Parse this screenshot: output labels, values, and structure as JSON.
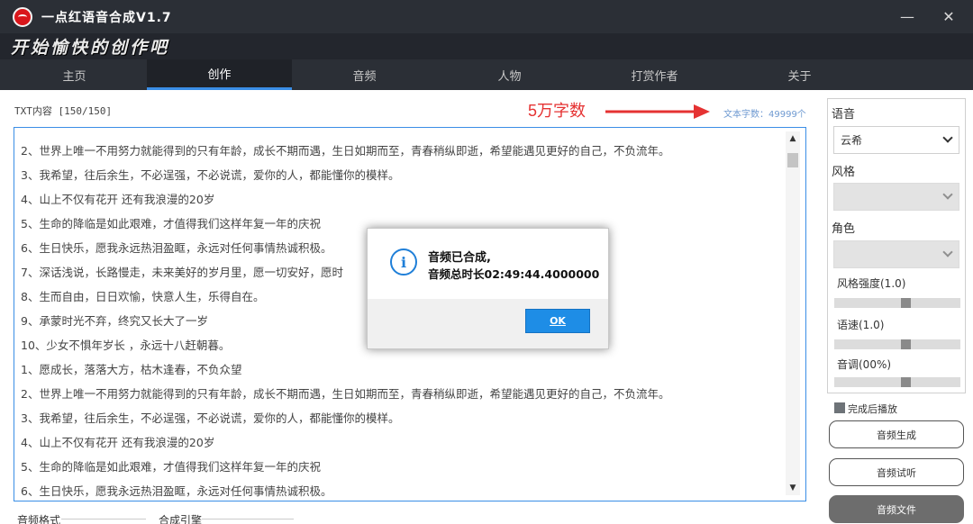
{
  "app": {
    "title": "一点红语音合成V1.7",
    "slogan": "开始愉快的创作吧"
  },
  "window_controls": {
    "minimize": "—",
    "close": "✕"
  },
  "nav": {
    "tabs": [
      "主页",
      "创作",
      "音频",
      "人物",
      "打赏作者",
      "关于"
    ],
    "active": "创作"
  },
  "editor": {
    "content_label": "TXT内容 [150/150]",
    "annotation": "5万字数",
    "char_count": "文本字数：49999个",
    "lines": [
      "2、世界上唯一不用努力就能得到的只有年龄，成长不期而遇，生日如期而至，青春稍纵即逝，希望能遇见更好的自己，不负流年。",
      "3、我希望，往后余生，不必逞强，不必说谎，爱你的人，都能懂你的模样。",
      "4、山上不仅有花开 还有我浪漫的20岁",
      "5、生命的降临是如此艰难，才值得我们这样年复一年的庆祝",
      "6、生日快乐，愿我永远热泪盈眶，永远对任何事情热诚积极。",
      "7、深话浅说，长路慢走，未来美好的岁月里，愿一切安好，愿时",
      "8、生而自由，日日欢愉，快意人生，乐得自在。",
      "9、承蒙时光不弃，终究又长大了一岁",
      "10、少女不惧年岁长 ，永远十八赶朝暮。",
      "1、愿成长，落落大方，枯木逢春，不负众望",
      "2、世界上唯一不用努力就能得到的只有年龄，成长不期而遇，生日如期而至，青春稍纵即逝，希望能遇见更好的自己，不负流年。",
      "3、我希望，往后余生，不必逞强，不必说谎，爱你的人，都能懂你的模样。",
      "4、山上不仅有花开 还有我浪漫的20岁",
      "5、生命的降临是如此艰难，才值得我们这样年复一年的庆祝",
      "6、生日快乐，愿我永远热泪盈眶，永远对任何事情热诚积极。"
    ]
  },
  "side": {
    "voice_label": "语音",
    "voice_value": "云希",
    "style_label": "风格",
    "role_label": "角色",
    "style_strength_label": "风格强度(1.0)",
    "style_strength": 0.5,
    "speed_label": "语速(1.0)",
    "speed": 0.5,
    "pitch_label": "音调(00%)",
    "pitch": 0.5,
    "autoplay_label": "完成后播放",
    "btn_generate": "音频生成",
    "btn_preview": "音频试听",
    "btn_file": "音频文件"
  },
  "bottom": {
    "format_label": "音频格式",
    "engine_label": "合成引擎"
  },
  "dialog": {
    "line1": "音频已合成,",
    "line2": "音频总时长02:49:44.4000000",
    "ok_label": "OK",
    "icon": "info-icon"
  },
  "colors": {
    "accent": "#3a8ee6",
    "annotation": "#e53232",
    "titlebar": "#2b2f36"
  }
}
